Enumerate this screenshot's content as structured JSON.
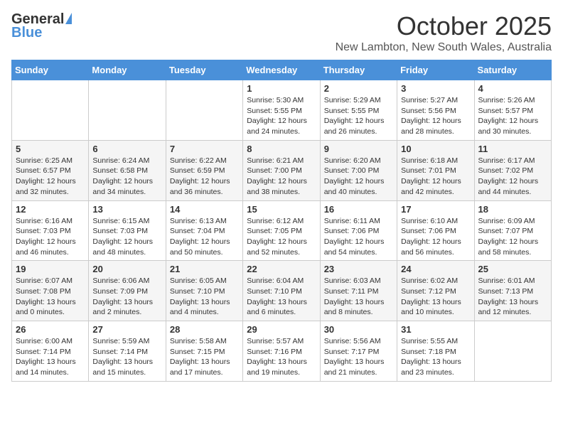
{
  "logo": {
    "general": "General",
    "blue": "Blue"
  },
  "title": "October 2025",
  "location": "New Lambton, New South Wales, Australia",
  "headers": [
    "Sunday",
    "Monday",
    "Tuesday",
    "Wednesday",
    "Thursday",
    "Friday",
    "Saturday"
  ],
  "weeks": [
    [
      {
        "day": "",
        "info": ""
      },
      {
        "day": "",
        "info": ""
      },
      {
        "day": "",
        "info": ""
      },
      {
        "day": "1",
        "info": "Sunrise: 5:30 AM\nSunset: 5:55 PM\nDaylight: 12 hours\nand 24 minutes."
      },
      {
        "day": "2",
        "info": "Sunrise: 5:29 AM\nSunset: 5:55 PM\nDaylight: 12 hours\nand 26 minutes."
      },
      {
        "day": "3",
        "info": "Sunrise: 5:27 AM\nSunset: 5:56 PM\nDaylight: 12 hours\nand 28 minutes."
      },
      {
        "day": "4",
        "info": "Sunrise: 5:26 AM\nSunset: 5:57 PM\nDaylight: 12 hours\nand 30 minutes."
      }
    ],
    [
      {
        "day": "5",
        "info": "Sunrise: 6:25 AM\nSunset: 6:57 PM\nDaylight: 12 hours\nand 32 minutes."
      },
      {
        "day": "6",
        "info": "Sunrise: 6:24 AM\nSunset: 6:58 PM\nDaylight: 12 hours\nand 34 minutes."
      },
      {
        "day": "7",
        "info": "Sunrise: 6:22 AM\nSunset: 6:59 PM\nDaylight: 12 hours\nand 36 minutes."
      },
      {
        "day": "8",
        "info": "Sunrise: 6:21 AM\nSunset: 7:00 PM\nDaylight: 12 hours\nand 38 minutes."
      },
      {
        "day": "9",
        "info": "Sunrise: 6:20 AM\nSunset: 7:00 PM\nDaylight: 12 hours\nand 40 minutes."
      },
      {
        "day": "10",
        "info": "Sunrise: 6:18 AM\nSunset: 7:01 PM\nDaylight: 12 hours\nand 42 minutes."
      },
      {
        "day": "11",
        "info": "Sunrise: 6:17 AM\nSunset: 7:02 PM\nDaylight: 12 hours\nand 44 minutes."
      }
    ],
    [
      {
        "day": "12",
        "info": "Sunrise: 6:16 AM\nSunset: 7:03 PM\nDaylight: 12 hours\nand 46 minutes."
      },
      {
        "day": "13",
        "info": "Sunrise: 6:15 AM\nSunset: 7:03 PM\nDaylight: 12 hours\nand 48 minutes."
      },
      {
        "day": "14",
        "info": "Sunrise: 6:13 AM\nSunset: 7:04 PM\nDaylight: 12 hours\nand 50 minutes."
      },
      {
        "day": "15",
        "info": "Sunrise: 6:12 AM\nSunset: 7:05 PM\nDaylight: 12 hours\nand 52 minutes."
      },
      {
        "day": "16",
        "info": "Sunrise: 6:11 AM\nSunset: 7:06 PM\nDaylight: 12 hours\nand 54 minutes."
      },
      {
        "day": "17",
        "info": "Sunrise: 6:10 AM\nSunset: 7:06 PM\nDaylight: 12 hours\nand 56 minutes."
      },
      {
        "day": "18",
        "info": "Sunrise: 6:09 AM\nSunset: 7:07 PM\nDaylight: 12 hours\nand 58 minutes."
      }
    ],
    [
      {
        "day": "19",
        "info": "Sunrise: 6:07 AM\nSunset: 7:08 PM\nDaylight: 13 hours\nand 0 minutes."
      },
      {
        "day": "20",
        "info": "Sunrise: 6:06 AM\nSunset: 7:09 PM\nDaylight: 13 hours\nand 2 minutes."
      },
      {
        "day": "21",
        "info": "Sunrise: 6:05 AM\nSunset: 7:10 PM\nDaylight: 13 hours\nand 4 minutes."
      },
      {
        "day": "22",
        "info": "Sunrise: 6:04 AM\nSunset: 7:10 PM\nDaylight: 13 hours\nand 6 minutes."
      },
      {
        "day": "23",
        "info": "Sunrise: 6:03 AM\nSunset: 7:11 PM\nDaylight: 13 hours\nand 8 minutes."
      },
      {
        "day": "24",
        "info": "Sunrise: 6:02 AM\nSunset: 7:12 PM\nDaylight: 13 hours\nand 10 minutes."
      },
      {
        "day": "25",
        "info": "Sunrise: 6:01 AM\nSunset: 7:13 PM\nDaylight: 13 hours\nand 12 minutes."
      }
    ],
    [
      {
        "day": "26",
        "info": "Sunrise: 6:00 AM\nSunset: 7:14 PM\nDaylight: 13 hours\nand 14 minutes."
      },
      {
        "day": "27",
        "info": "Sunrise: 5:59 AM\nSunset: 7:14 PM\nDaylight: 13 hours\nand 15 minutes."
      },
      {
        "day": "28",
        "info": "Sunrise: 5:58 AM\nSunset: 7:15 PM\nDaylight: 13 hours\nand 17 minutes."
      },
      {
        "day": "29",
        "info": "Sunrise: 5:57 AM\nSunset: 7:16 PM\nDaylight: 13 hours\nand 19 minutes."
      },
      {
        "day": "30",
        "info": "Sunrise: 5:56 AM\nSunset: 7:17 PM\nDaylight: 13 hours\nand 21 minutes."
      },
      {
        "day": "31",
        "info": "Sunrise: 5:55 AM\nSunset: 7:18 PM\nDaylight: 13 hours\nand 23 minutes."
      },
      {
        "day": "",
        "info": ""
      }
    ]
  ]
}
